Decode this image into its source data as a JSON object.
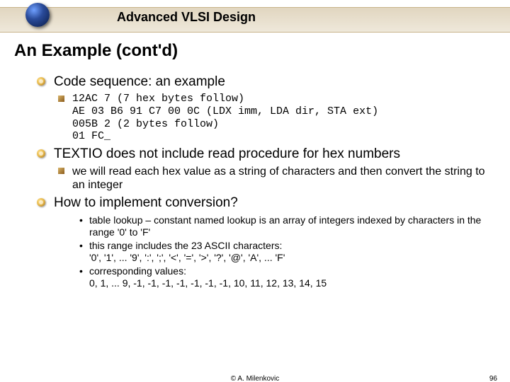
{
  "header": {
    "title": "Advanced VLSI Design"
  },
  "title": "An Example (cont'd)",
  "bullets": [
    {
      "text": "Code sequence: an example",
      "sub": [
        {
          "text": "12AC 7 (7 hex bytes follow)\nAE 03 B6 91 C7 00 0C (LDX imm, LDA dir, STA ext)\n005B 2 (2 bytes follow)\n01 FC_"
        }
      ]
    },
    {
      "text": "TEXTIO does not include read procedure for hex numbers",
      "sub": [
        {
          "text": "we will read each hex value as a string of characters and then convert the string to an integer"
        }
      ]
    },
    {
      "text": "How to implement conversion?",
      "sub": [
        {
          "text": "table lookup – constant named lookup is an array of integers indexed by characters in the range '0' to 'F'"
        },
        {
          "text": "this range includes the 23 ASCII characters:\n'0', '1', ... '9', ':', ';', '<', '=', '>', '?', '@', 'A', ... 'F'"
        },
        {
          "text": "corresponding values:\n0, 1, ... 9, -1, -1, -1, -1, -1, -1, -1, 10, 11, 12, 13, 14, 15"
        }
      ]
    }
  ],
  "footer": {
    "copyright": "© A. Milenkovic",
    "page": "96"
  }
}
